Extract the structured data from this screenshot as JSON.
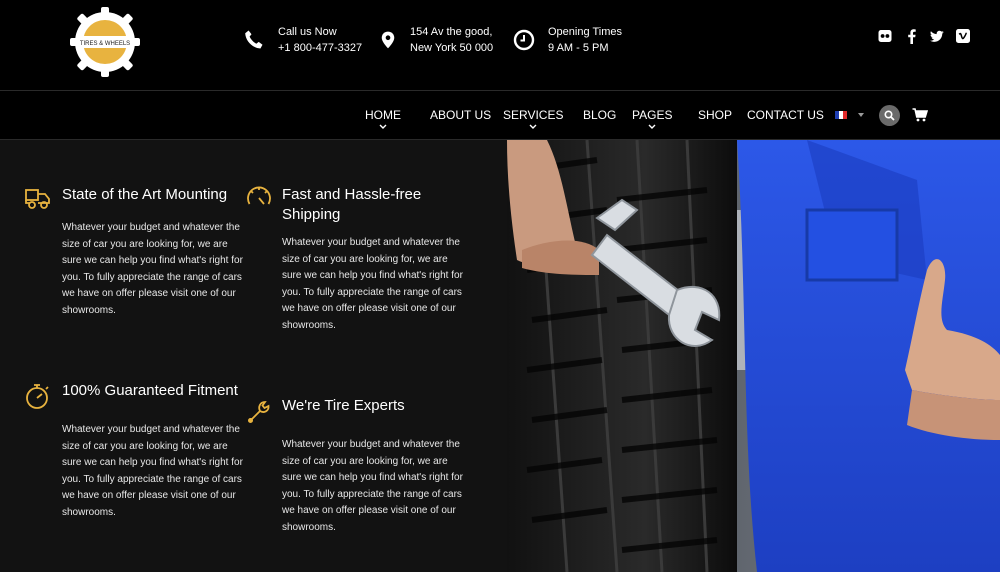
{
  "brand": {
    "logo_text": "TIRES & WHEELS",
    "accent": "#e8b33f"
  },
  "contacts": {
    "call": {
      "label": "Call us Now",
      "value": "+1 800-477-3327",
      "icon": "phone-icon"
    },
    "address": {
      "line1": "154 Av the good,",
      "line2": "New York 50 000",
      "icon": "map-pin-icon"
    },
    "hours": {
      "label": "Opening Times",
      "value": "9 AM - 5 PM",
      "icon": "clock-icon"
    }
  },
  "social": [
    "flickr-icon",
    "facebook-icon",
    "twitter-icon",
    "vimeo-icon"
  ],
  "nav": {
    "items": [
      {
        "label": "HOME",
        "dropdown": true
      },
      {
        "label": "ABOUT US",
        "dropdown": false
      },
      {
        "label": "SERVICES",
        "dropdown": true
      },
      {
        "label": "BLOG",
        "dropdown": false
      },
      {
        "label": "PAGES",
        "dropdown": true
      },
      {
        "label": "SHOP",
        "dropdown": false
      },
      {
        "label": "CONTACT US",
        "dropdown": false
      }
    ],
    "language_flag": "fr"
  },
  "features": [
    {
      "title": "State of the Art Mounting",
      "body": "Whatever your budget and whatever the size of car you are looking for, we are sure we can help you find what's right for you. To fully appreciate the range of cars we have on offer please visit one of our showrooms.",
      "icon": "tow-truck-icon"
    },
    {
      "title": "Fast and Hassle-free Shipping",
      "body": "Whatever your budget and whatever the size of car you are looking for, we are sure we can help you find what's right for you. To fully appreciate the range of cars we have on offer please visit one of our showrooms.",
      "icon": "speedometer-icon"
    },
    {
      "title": "100% Guaranteed Fitment",
      "body": "Whatever your budget and whatever the size of car you are looking for, we are sure we can help you find what's right for you. To fully appreciate the range of cars we have on offer please visit one of our showrooms.",
      "icon": "stopwatch-icon"
    },
    {
      "title": "We're Tire Experts",
      "body": "Whatever your budget and whatever the size of car you are looking for, we are sure we can help you find what's right for you. To fully appreciate the range of cars we have on offer please visit one of our showrooms.",
      "icon": "wrench-icon"
    }
  ],
  "hero": {
    "image": "mechanic-holding-tire-and-wrench-photo"
  }
}
